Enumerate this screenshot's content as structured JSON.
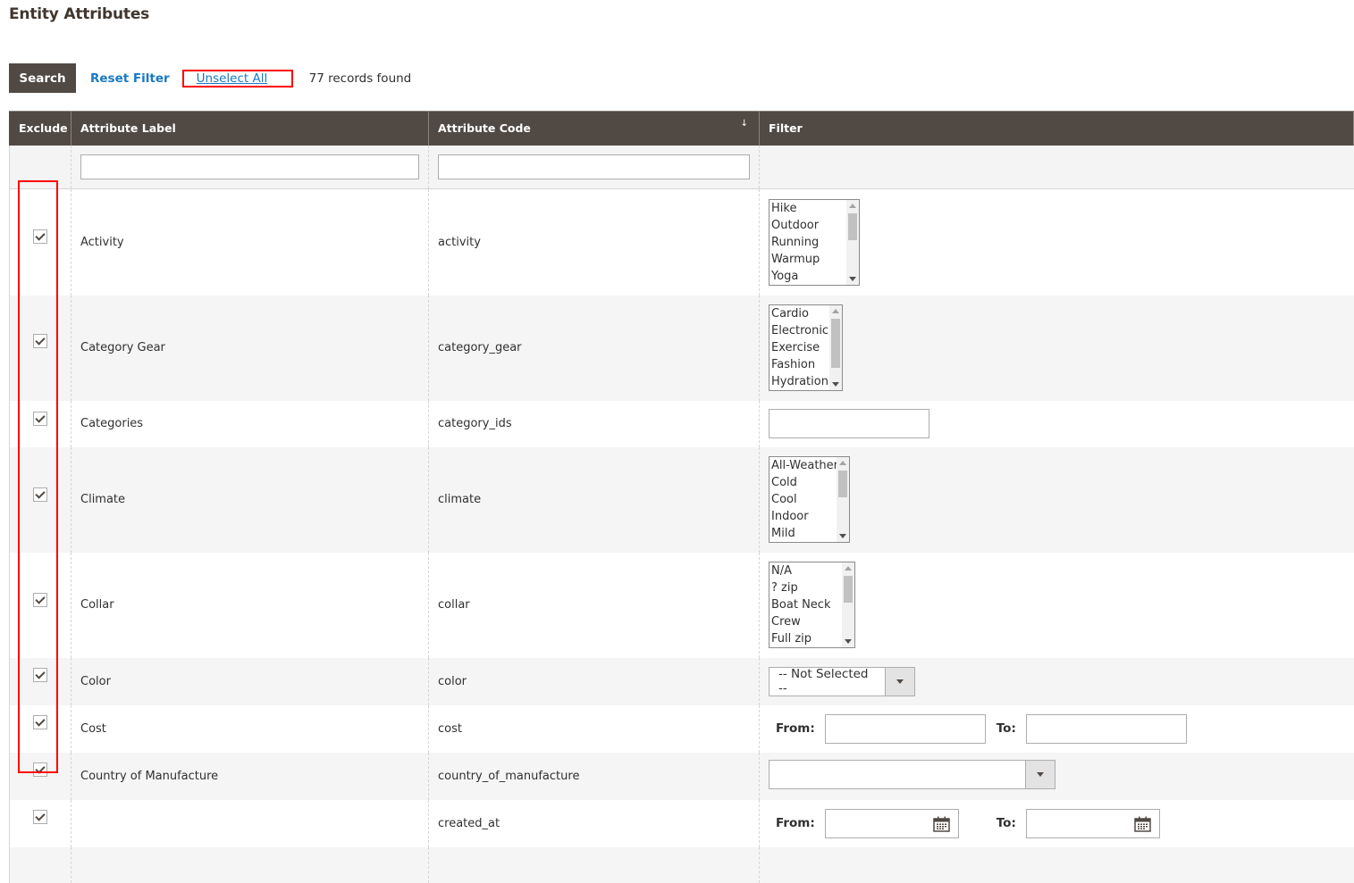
{
  "page": {
    "title": "Entity Attributes"
  },
  "toolbar": {
    "search_label": "Search",
    "reset_label": "Reset Filter",
    "unselect_label": "Unselect All",
    "records_text": "77 records found"
  },
  "grid": {
    "columns": [
      {
        "label": "Exclude"
      },
      {
        "label": "Attribute Label"
      },
      {
        "label": "Attribute Code",
        "sort_indicator": "↓"
      },
      {
        "label": "Filter"
      }
    ],
    "filters": {
      "label_value": "",
      "code_value": ""
    },
    "rows": [
      {
        "excluded": true,
        "label": "Activity",
        "code": "activity",
        "filter": {
          "type": "multiselect",
          "options": [
            "Hike",
            "Outdoor",
            "Running",
            "Warmup",
            "Yoga"
          ]
        }
      },
      {
        "excluded": true,
        "label": "Category Gear",
        "code": "category_gear",
        "filter": {
          "type": "multiselect",
          "options": [
            "Cardio",
            "Electronic",
            "Exercise",
            "Fashion",
            "Hydration"
          ]
        }
      },
      {
        "excluded": true,
        "label": "Categories",
        "code": "category_ids",
        "filter": {
          "type": "text",
          "value": ""
        }
      },
      {
        "excluded": true,
        "label": "Climate",
        "code": "climate",
        "filter": {
          "type": "multiselect",
          "options": [
            "All-Weather",
            "Cold",
            "Cool",
            "Indoor",
            "Mild"
          ]
        }
      },
      {
        "excluded": true,
        "label": "Collar",
        "code": "collar",
        "filter": {
          "type": "multiselect",
          "options": [
            "N/A",
            "? zip",
            "Boat Neck",
            "Crew",
            "Full zip"
          ]
        }
      },
      {
        "excluded": true,
        "label": "Color",
        "code": "color",
        "filter": {
          "type": "select",
          "selected": "-- Not Selected --"
        }
      },
      {
        "excluded": true,
        "label": "Cost",
        "code": "cost",
        "filter": {
          "type": "range",
          "from_label": "From:",
          "to_label": "To:",
          "from": "",
          "to": ""
        }
      },
      {
        "excluded": true,
        "label": "Country of Manufacture",
        "code": "country_of_manufacture",
        "filter": {
          "type": "select",
          "selected": ""
        }
      },
      {
        "excluded": true,
        "label": "",
        "code": "created_at",
        "filter": {
          "type": "date-range",
          "from_label": "From:",
          "to_label": "To:",
          "from": "",
          "to": ""
        }
      }
    ]
  },
  "colors": {
    "header_bg": "#514943",
    "link": "#1979c3",
    "highlight": "#ff0000",
    "alt_row": "#f5f5f5"
  }
}
